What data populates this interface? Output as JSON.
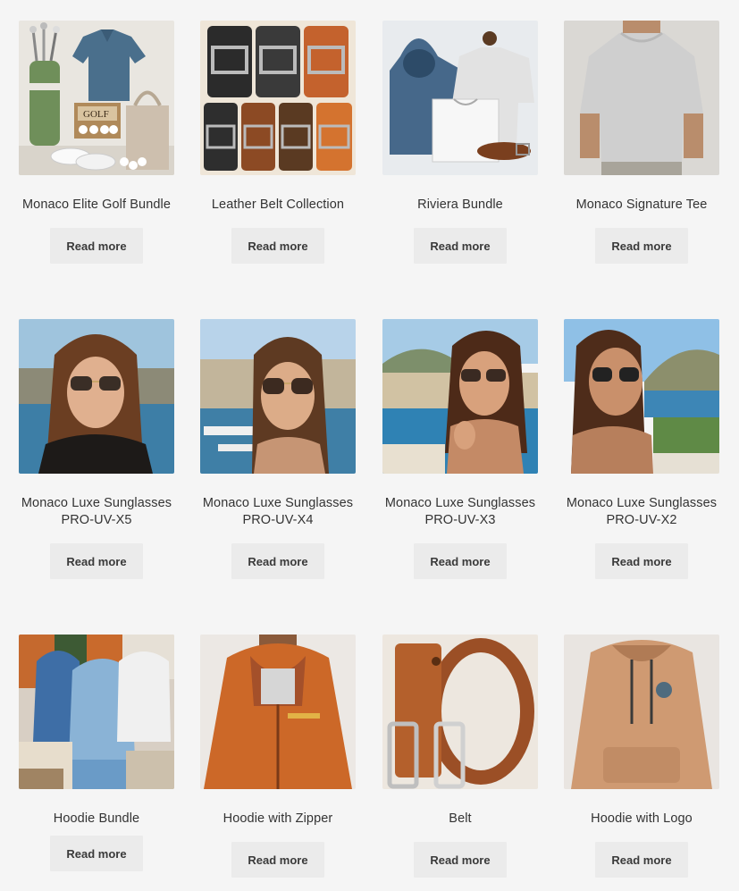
{
  "products": [
    {
      "title": "Monaco Elite Golf Bundle",
      "button": "Read more",
      "image": "golf-bundle-image"
    },
    {
      "title": "Leather Belt Collection",
      "button": "Read more",
      "image": "belt-collection-image"
    },
    {
      "title": "Riviera Bundle",
      "button": "Read more",
      "image": "riviera-bundle-image"
    },
    {
      "title": "Monaco Signature Tee",
      "button": "Read more",
      "image": "signature-tee-image"
    },
    {
      "title": "Monaco Luxe Sunglasses PRO-UV-X5",
      "button": "Read more",
      "image": "sunglasses-x5-image"
    },
    {
      "title": "Monaco Luxe Sunglasses PRO-UV-X4",
      "button": "Read more",
      "image": "sunglasses-x4-image"
    },
    {
      "title": "Monaco Luxe Sunglasses PRO-UV-X3",
      "button": "Read more",
      "image": "sunglasses-x3-image"
    },
    {
      "title": "Monaco Luxe Sunglasses PRO-UV-X2",
      "button": "Read more",
      "image": "sunglasses-x2-image"
    },
    {
      "title": "Hoodie Bundle",
      "button": "Read more",
      "image": "hoodie-bundle-image"
    },
    {
      "title": "Hoodie with Zipper",
      "button": "Read more",
      "image": "hoodie-zipper-image"
    },
    {
      "title": "Belt",
      "button": "Read more",
      "image": "belt-image"
    },
    {
      "title": "Hoodie with Logo",
      "button": "Read more",
      "image": "hoodie-logo-image"
    }
  ],
  "golf_box_label": "GOLF",
  "colors": {
    "background": "#f5f5f5",
    "button_bg": "#ebebeb",
    "button_text": "#3a3a3a",
    "title_text": "#333333"
  }
}
